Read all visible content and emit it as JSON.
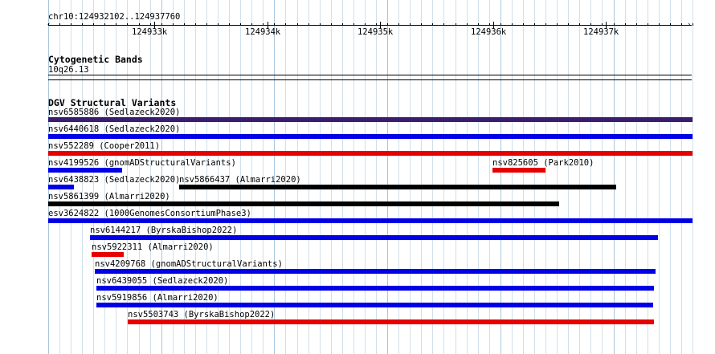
{
  "ruler": {
    "location": "chr10:124932102..124937760",
    "ticks": [
      "124933k",
      "124934k",
      "124935k",
      "124936k",
      "124937k"
    ]
  },
  "cytoband_track": {
    "title": "Cytogenetic Bands",
    "band": "10q26.13"
  },
  "dgv_track": {
    "title": "DGV Structural Variants",
    "features": [
      {
        "label": "nsv6585886 (Sedlazeck2020)",
        "color": "#3a1d6e"
      },
      {
        "label": "nsv6440618 (Sedlazeck2020)",
        "color": "#0000e6"
      },
      {
        "label": "nsv552289 (Cooper2011)",
        "color": "#e60000"
      },
      {
        "label": "nsv4199526 (gnomADStructuralVariants)",
        "color": "#0000e6"
      },
      {
        "label": "nsv825605 (Park2010)",
        "color": "#e60000"
      },
      {
        "label": "nsv6438823 (Sedlazeck2020)",
        "color": "#0000e6"
      },
      {
        "label": "nsv5866437 (Almarri2020)",
        "color": "#000000"
      },
      {
        "label": "nsv5861399 (Almarri2020)",
        "color": "#000000"
      },
      {
        "label": "esv3624822 (1000GenomesConsortiumPhase3)",
        "color": "#0000e6"
      },
      {
        "label": "nsv6144217 (ByrskaBishop2022)",
        "color": "#0000e6"
      },
      {
        "label": "nsv5922311 (Almarri2020)",
        "color": "#e60000"
      },
      {
        "label": "nsv4209768 (gnomADStructuralVariants)",
        "color": "#0000e6"
      },
      {
        "label": "nsv6439055 (Sedlazeck2020)",
        "color": "#0000e6"
      },
      {
        "label": "nsv5919856 (Almarri2020)",
        "color": "#0000e6"
      },
      {
        "label": "nsv5503743 (ByrskaBishop2022)",
        "color": "#e60000"
      }
    ]
  }
}
